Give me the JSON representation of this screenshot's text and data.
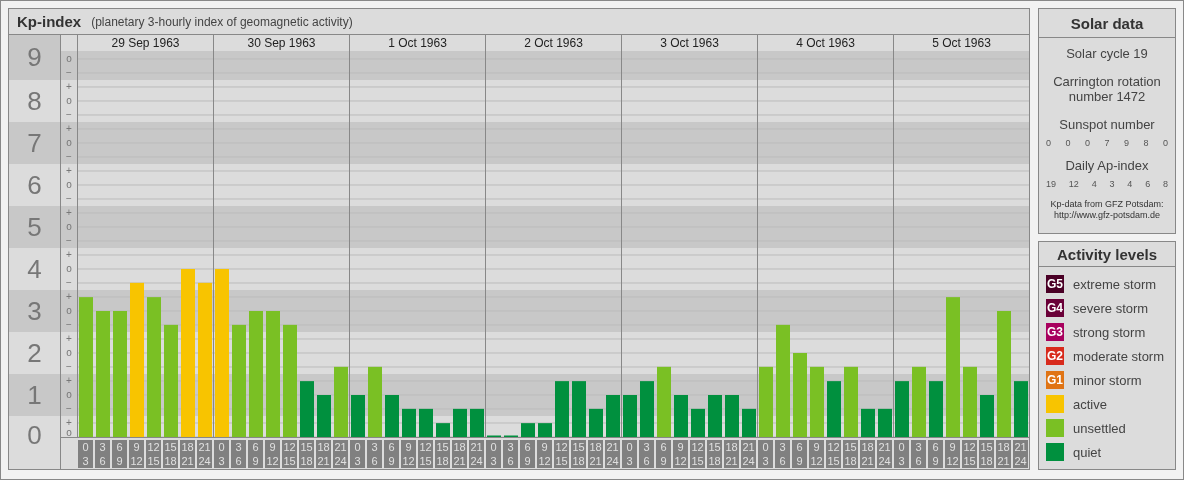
{
  "kp": {
    "title": "Kp-index",
    "subtitle": "(planetary 3-hourly index of geomagnetic activity)",
    "sub_labels": [
      "o",
      "−",
      "+",
      "o",
      "−",
      "+",
      "o",
      "−",
      "+",
      "o",
      "−",
      "+",
      "o",
      "−",
      "+",
      "o",
      "−",
      "+",
      "o",
      "−",
      "+",
      "o",
      "−",
      "+",
      "o",
      "−",
      "+",
      "o"
    ],
    "days": [
      {
        "date": "29 Sep 1963",
        "slots": [
          [
            "0",
            "3"
          ],
          [
            "3",
            "6"
          ],
          [
            "6",
            "9"
          ],
          [
            "9",
            "12"
          ],
          [
            "12",
            "15"
          ],
          [
            "15",
            "18"
          ],
          [
            "18",
            "21"
          ],
          [
            "21",
            "24"
          ]
        ]
      },
      {
        "date": "30 Sep 1963",
        "slots": [
          [
            "0",
            "3"
          ],
          [
            "3",
            "6"
          ],
          [
            "6",
            "9"
          ],
          [
            "9",
            "12"
          ],
          [
            "12",
            "15"
          ],
          [
            "15",
            "18"
          ],
          [
            "18",
            "21"
          ],
          [
            "21",
            "24"
          ]
        ]
      },
      {
        "date": "1 Oct 1963",
        "slots": [
          [
            "0",
            "3"
          ],
          [
            "3",
            "6"
          ],
          [
            "6",
            "9"
          ],
          [
            "9",
            "12"
          ],
          [
            "12",
            "15"
          ],
          [
            "15",
            "18"
          ],
          [
            "18",
            "21"
          ],
          [
            "21",
            "24"
          ]
        ]
      },
      {
        "date": "2 Oct 1963",
        "slots": [
          [
            "0",
            "3"
          ],
          [
            "3",
            "6"
          ],
          [
            "6",
            "9"
          ],
          [
            "9",
            "12"
          ],
          [
            "12",
            "15"
          ],
          [
            "15",
            "18"
          ],
          [
            "18",
            "21"
          ],
          [
            "21",
            "24"
          ]
        ]
      },
      {
        "date": "3 Oct 1963",
        "slots": [
          [
            "0",
            "3"
          ],
          [
            "3",
            "6"
          ],
          [
            "6",
            "9"
          ],
          [
            "9",
            "12"
          ],
          [
            "12",
            "15"
          ],
          [
            "15",
            "18"
          ],
          [
            "18",
            "21"
          ],
          [
            "21",
            "24"
          ]
        ]
      },
      {
        "date": "4 Oct 1963",
        "slots": [
          [
            "0",
            "3"
          ],
          [
            "3",
            "6"
          ],
          [
            "6",
            "9"
          ],
          [
            "9",
            "12"
          ],
          [
            "12",
            "15"
          ],
          [
            "15",
            "18"
          ],
          [
            "18",
            "21"
          ],
          [
            "21",
            "24"
          ]
        ]
      },
      {
        "date": "5 Oct 1963",
        "slots": [
          [
            "0",
            "3"
          ],
          [
            "3",
            "6"
          ],
          [
            "6",
            "9"
          ],
          [
            "9",
            "12"
          ],
          [
            "12",
            "15"
          ],
          [
            "15",
            "18"
          ],
          [
            "18",
            "21"
          ],
          [
            "21",
            "24"
          ]
        ]
      }
    ],
    "chart_data": {
      "type": "bar",
      "ylim": [
        0,
        9.19
      ],
      "grid": true,
      "yticks": [
        {
          "value": 0,
          "label": "0"
        },
        {
          "value": 1,
          "label": "1"
        },
        {
          "value": 2,
          "label": "2"
        },
        {
          "value": 3,
          "label": "3"
        },
        {
          "value": 4,
          "label": "4"
        },
        {
          "value": 5,
          "label": "5"
        },
        {
          "value": 6,
          "label": "6"
        },
        {
          "value": 7,
          "label": "7"
        },
        {
          "value": 8,
          "label": "8"
        },
        {
          "value": 9,
          "label": "9"
        }
      ],
      "values": [
        3.33,
        3,
        3,
        3.67,
        3.33,
        2.67,
        4,
        3.67,
        4,
        2.67,
        3,
        3,
        2.67,
        1.33,
        1,
        1.67,
        1,
        1.67,
        1,
        0.67,
        0.67,
        0.33,
        0.67,
        0.67,
        0,
        0,
        0.33,
        0.33,
        1.33,
        1.33,
        0.67,
        1,
        1,
        1.33,
        1.67,
        1,
        0.67,
        1,
        1,
        0.67,
        1.67,
        2.67,
        2,
        1.67,
        1.33,
        1.67,
        0.67,
        0.67,
        1.33,
        1.67,
        1.33,
        3.33,
        1.67,
        1,
        3,
        1.33
      ]
    }
  },
  "solar": {
    "title": "Solar data",
    "cycle": "Solar cycle 19",
    "rotation": "Carrington rotation number 1472",
    "sunspot_title": "Sunspot number",
    "sunspots": [
      "0",
      "0",
      "0",
      "7",
      "9",
      "8",
      "0"
    ],
    "ap_title": "Daily Ap-index",
    "ap": [
      "19",
      "12",
      "4",
      "3",
      "4",
      "6",
      "8"
    ],
    "credit": [
      "Kp-data from GFZ Potsdam:",
      "http://www.gfz-potsdam.de"
    ]
  },
  "legend": {
    "title": "Activity levels",
    "items": [
      {
        "kind": "g5",
        "badge": "G5",
        "label": "extreme storm",
        "color": "#4a0026"
      },
      {
        "kind": "g4",
        "badge": "G4",
        "label": "severe storm",
        "color": "#6a0038"
      },
      {
        "kind": "g3",
        "badge": "G3",
        "label": "strong storm",
        "color": "#a8005e"
      },
      {
        "kind": "g2",
        "badge": "G2",
        "label": "moderate storm",
        "color": "#d82a1c"
      },
      {
        "kind": "g1",
        "badge": "G1",
        "label": "minor storm",
        "color": "#e07414"
      },
      {
        "kind": "active",
        "label": "active",
        "color": "#f8c400"
      },
      {
        "kind": "unsettled",
        "label": "unsettled",
        "color": "#7ac024"
      },
      {
        "kind": "quiet",
        "label": "quiet",
        "color": "#00903e"
      }
    ]
  }
}
